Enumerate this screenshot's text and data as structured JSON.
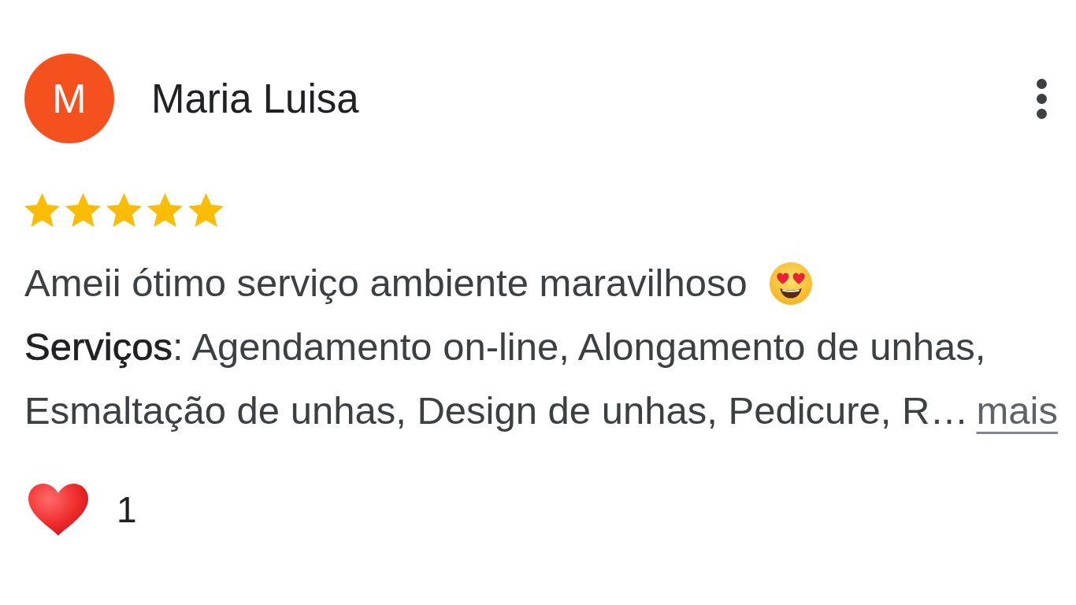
{
  "review": {
    "author": {
      "initial": "M",
      "name": "Maria Luisa"
    },
    "stars": 5,
    "text": "Ameii ótimo serviço ambiente maravilhoso",
    "services": "**Serviços**: Agendamento on-line, Alongamento de unhas, Esmaltação de unhas, Design de unhas, Pedicure, R…",
    "more_link": "mais",
    "reaction": {
      "count": "1"
    }
  }
}
